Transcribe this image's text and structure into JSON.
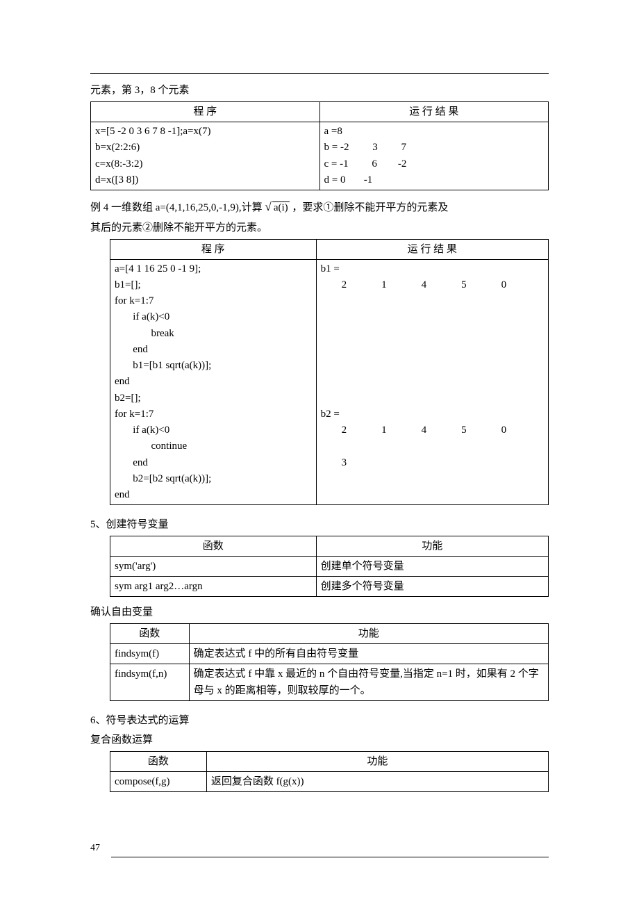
{
  "top_line": "元素，第 3，8 个元素",
  "table1": {
    "h1": "程    序",
    "h2": "运 行 结 果",
    "code": "x=[5 -2 0 3 6 7 8 -1];a=x(7)\nb=x(2:2:6)\nc=x(8:-3:2)\nd=x([3 8])",
    "result": "a =8\nb = -2         3         7\nc = -1         6        -2\nd = 0       -1"
  },
  "ex4": {
    "pre": "例 4  一维数组 a=(4,1,16,25,0,-1,9),计算",
    "radicand": "a(i)",
    "post": "，要求①删除不能开平方的元素及",
    "line2": "其后的元素②删除不能开平方的元素。"
  },
  "table2": {
    "h1": "程    序",
    "h2": "运 行 结 果",
    "code": "a=[4 1 16 25 0 -1 9];\nb1=[];\nfor k=1:7\n       if a(k)<0\n              break\n       end\n       b1=[b1 sqrt(a(k))];\nend\nb2=[];\nfor k=1:7\n       if a(k)<0\n              continue\n       end\n       b2=[b2 sqrt(a(k))];\nend",
    "r_b1_label": "b1 =",
    "r_b1_vals": [
      "2",
      "1",
      "4",
      "5",
      "0"
    ],
    "r_b2_label": "b2 =",
    "r_b2_vals1": [
      "2",
      "1",
      "4",
      "5",
      "0"
    ],
    "r_b2_vals2": "3"
  },
  "sec5": "5、创建符号变量",
  "table3": {
    "h1": "函数",
    "h2": "功能",
    "rows": [
      [
        "sym('arg')",
        "创建单个符号变量"
      ],
      [
        "sym arg1 arg2…argn",
        "创建多个符号变量"
      ]
    ]
  },
  "free_var": "确认自由变量",
  "table4": {
    "h1": "函数",
    "h2": "功能",
    "rows": [
      [
        "findsym(f)",
        "确定表达式 f 中的所有自由符号变量"
      ],
      [
        "findsym(f,n)",
        "确定表达式 f 中靠 x 最近的 n 个自由符号变量,当指定 n=1 时，如果有 2 个字母与 x 的距离相等，则取较厚的一个。"
      ]
    ]
  },
  "sec6": "6、符号表达式的运算",
  "composite": "复合函数运算",
  "table5": {
    "h1": "函数",
    "h2": "功能",
    "rows": [
      [
        "compose(f,g)",
        "返回复合函数 f(g(x))"
      ]
    ]
  },
  "page_num": "47"
}
